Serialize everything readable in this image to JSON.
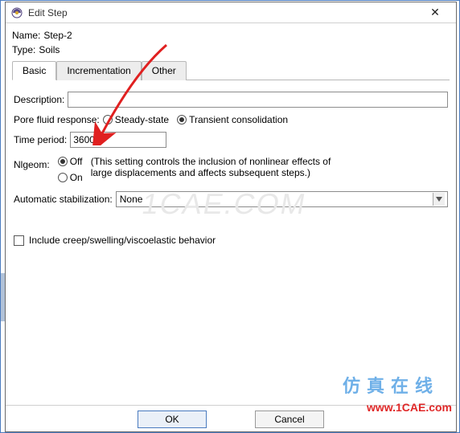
{
  "window": {
    "title": "Edit Step"
  },
  "fields": {
    "name_label": "Name:",
    "name_value": "Step-2",
    "type_label": "Type:",
    "type_value": "Soils"
  },
  "tabs": {
    "basic": "Basic",
    "incrementation": "Incrementation",
    "other": "Other"
  },
  "basic": {
    "description_label": "Description:",
    "description_value": "",
    "pore_label": "Pore fluid response:",
    "pore_options": {
      "steady": "Steady-state",
      "transient": "Transient consolidation"
    },
    "time_label": "Time period:",
    "time_value": "36000",
    "nlgeom_label": "Nlgeom:",
    "nlgeom_options": {
      "off": "Off",
      "on": "On"
    },
    "nlgeom_hint": "(This setting controls the inclusion of nonlinear effects of large displacements and affects subsequent steps.)",
    "stab_label": "Automatic stabilization:",
    "stab_value": "None",
    "creep_label": "Include creep/swelling/viscoelastic behavior"
  },
  "buttons": {
    "ok": "OK",
    "cancel": "Cancel"
  },
  "watermark": {
    "bg": "1CAE.COM",
    "chars": "仿真在线",
    "url": "www.1CAE.com"
  }
}
